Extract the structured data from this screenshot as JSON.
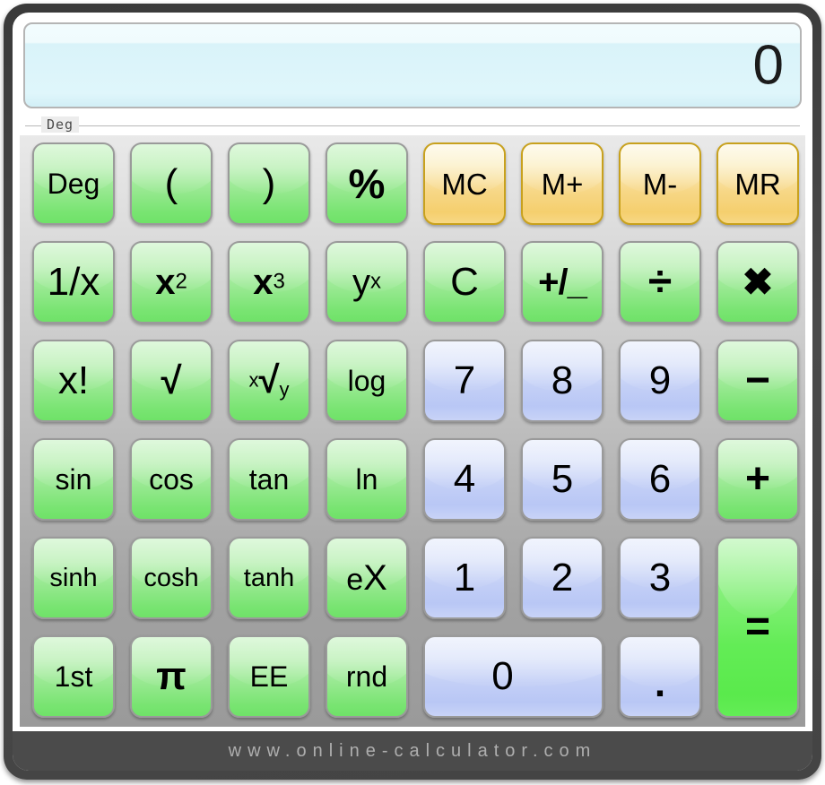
{
  "display": {
    "value": "0",
    "mode_label": "Deg"
  },
  "footer": {
    "url": "www.online-calculator.com"
  },
  "colors": {
    "function_key": "#93e88c",
    "number_key": "#c3cff6",
    "memory_key": "#f7d786",
    "equals_key": "#63ec56",
    "bezel": "#444444",
    "panel_top": "#e9e9e9",
    "panel_bottom": "#9a9a9a",
    "display_bg": "#dff6fb",
    "footer_bg": "#4b4b4b",
    "footer_text": "#aeaeae"
  },
  "keypad": {
    "rows": [
      [
        {
          "id": "deg",
          "label": "Deg",
          "type": "green",
          "style": "word"
        },
        {
          "id": "open-paren",
          "label": "(",
          "type": "green",
          "style": "paren"
        },
        {
          "id": "close-paren",
          "label": ")",
          "type": "green",
          "style": "paren"
        },
        {
          "id": "percent",
          "label": "%",
          "type": "green",
          "style": "pct"
        },
        {
          "id": "memory-clear",
          "label": "MC",
          "type": "gold",
          "style": "mem"
        },
        {
          "id": "memory-add",
          "label": "M+",
          "type": "gold",
          "style": "mem"
        },
        {
          "id": "memory-subtract",
          "label": "M-",
          "type": "gold",
          "style": "mem"
        },
        {
          "id": "memory-recall",
          "label": "MR",
          "type": "gold",
          "style": "mem"
        }
      ],
      [
        {
          "id": "reciprocal",
          "label": "1/x",
          "type": "green",
          "style": "num-light"
        },
        {
          "id": "x-squared",
          "label": "x2",
          "base": "x",
          "sup": "2",
          "type": "green",
          "style": "power"
        },
        {
          "id": "x-cubed",
          "label": "x3",
          "base": "x",
          "sup": "3",
          "type": "green",
          "style": "power"
        },
        {
          "id": "y-to-x",
          "label": "yx",
          "base": "y",
          "sup": "x",
          "type": "green",
          "style": "power-light"
        },
        {
          "id": "clear",
          "label": "C",
          "type": "green",
          "style": "num-light"
        },
        {
          "id": "sign-toggle",
          "label": "+/_",
          "type": "green",
          "style": "plusminus"
        },
        {
          "id": "divide",
          "label": "÷",
          "type": "green",
          "style": "opbig"
        },
        {
          "id": "multiply",
          "label": "✖",
          "type": "green",
          "style": "op"
        }
      ],
      [
        {
          "id": "factorial",
          "label": "x!",
          "type": "green",
          "style": "num-light"
        },
        {
          "id": "square-root",
          "label": "√",
          "type": "green",
          "style": "root"
        },
        {
          "id": "nth-root",
          "label": "x√y",
          "pre": "x",
          "base": "√",
          "sub": "y",
          "type": "green",
          "style": "nthroot"
        },
        {
          "id": "log",
          "label": "log",
          "type": "green",
          "style": "word"
        },
        {
          "id": "digit-7",
          "label": "7",
          "type": "blue",
          "style": "num"
        },
        {
          "id": "digit-8",
          "label": "8",
          "type": "blue",
          "style": "num"
        },
        {
          "id": "digit-9",
          "label": "9",
          "type": "blue",
          "style": "num"
        },
        {
          "id": "subtract",
          "label": "−",
          "type": "green",
          "style": "opbig"
        }
      ],
      [
        {
          "id": "sin",
          "label": "sin",
          "type": "green",
          "style": "word"
        },
        {
          "id": "cos",
          "label": "cos",
          "type": "green",
          "style": "word"
        },
        {
          "id": "tan",
          "label": "tan",
          "type": "green",
          "style": "word"
        },
        {
          "id": "ln",
          "label": "ln",
          "type": "green",
          "style": "word"
        },
        {
          "id": "digit-4",
          "label": "4",
          "type": "blue",
          "style": "num"
        },
        {
          "id": "digit-5",
          "label": "5",
          "type": "blue",
          "style": "num"
        },
        {
          "id": "digit-6",
          "label": "6",
          "type": "blue",
          "style": "num"
        },
        {
          "id": "add",
          "label": "+",
          "type": "green",
          "style": "opbig"
        }
      ],
      [
        {
          "id": "sinh",
          "label": "sinh",
          "type": "green",
          "style": "word-small"
        },
        {
          "id": "cosh",
          "label": "cosh",
          "type": "green",
          "style": "word-small"
        },
        {
          "id": "tanh",
          "label": "tanh",
          "type": "green",
          "style": "word-small"
        },
        {
          "id": "e-to-x",
          "label": "eX",
          "type": "green",
          "style": "ex"
        },
        {
          "id": "digit-1",
          "label": "1",
          "type": "blue",
          "style": "num"
        },
        {
          "id": "digit-2",
          "label": "2",
          "type": "blue",
          "style": "num"
        },
        {
          "id": "digit-3",
          "label": "3",
          "type": "blue",
          "style": "num"
        },
        {
          "id": "equals",
          "label": "=",
          "type": "equals",
          "style": "opbig",
          "span_rows": 2
        }
      ],
      [
        {
          "id": "first-function",
          "label": "1st",
          "type": "green",
          "style": "word"
        },
        {
          "id": "pi",
          "label": "π",
          "type": "green",
          "style": "pi"
        },
        {
          "id": "exponent-entry",
          "label": "EE",
          "type": "green",
          "style": "word"
        },
        {
          "id": "round",
          "label": "rnd",
          "type": "green",
          "style": "word"
        },
        {
          "id": "digit-0",
          "label": "0",
          "type": "blue",
          "style": "num",
          "span_cols": 2
        },
        {
          "id": "decimal-point",
          "label": ".",
          "type": "blue",
          "style": "dot"
        }
      ]
    ]
  }
}
